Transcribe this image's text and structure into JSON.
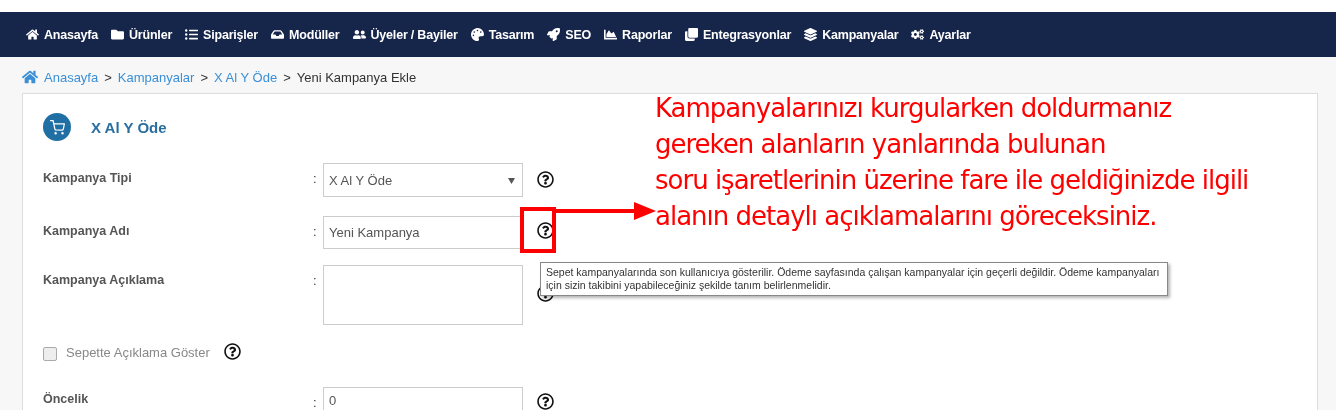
{
  "nav": [
    {
      "label": "Anasayfa"
    },
    {
      "label": "Ürünler"
    },
    {
      "label": "Siparişler"
    },
    {
      "label": "Modüller"
    },
    {
      "label": "Üyeler / Bayiler"
    },
    {
      "label": "Tasarım"
    },
    {
      "label": "SEO"
    },
    {
      "label": "Raporlar"
    },
    {
      "label": "Entegrasyonlar"
    },
    {
      "label": "Kampanyalar"
    },
    {
      "label": "Ayarlar"
    }
  ],
  "breadcrumb": [
    {
      "label": "Anasayfa",
      "link": true
    },
    {
      "separator": ">",
      "label": "Kampanyalar",
      "link": true
    },
    {
      "separator": ">",
      "label": "X Al Y Öde",
      "link": true
    },
    {
      "separator": ">",
      "label": "Yeni Kampanya Ekle",
      "link": false
    }
  ],
  "card": {
    "title": "X Al Y Öde"
  },
  "fields": [
    {
      "kind": "select",
      "label": "Kampanya Tipi",
      "colon": ":",
      "value": "X Al Y Öde"
    },
    {
      "kind": "input",
      "label": "Kampanya Adı",
      "colon": ":",
      "value": "Yeni Kampanya",
      "highlighted": true
    },
    {
      "kind": "textarea",
      "label": "Kampanya Açıklama",
      "colon": ":"
    },
    {
      "kind": "checkbox",
      "label": "Sepette Açıklama Göster",
      "checked": false
    },
    {
      "kind": "input",
      "label": "Öncelik",
      "colon": ":",
      "value": "0",
      "highlighted": false
    }
  ],
  "tooltip": "Sepet kampanyalarında son kullanıcıya gösterilir. Ödeme sayfasında çalışan kampanyalar için geçerli değildir. Ödeme kampanyaları için sizin takibini yapabileceğiniz şekilde tanım belirlenmelidir.",
  "annotation": {
    "lines": [
      "Kampanyalarınızı kurgularken doldurmanız",
      "gereken alanların yanlarında bulunan",
      "soru işaretlerinin üzerine fare ile geldiğinizde ilgili",
      "alanın detaylı açıklamalarını göreceksiniz."
    ]
  }
}
